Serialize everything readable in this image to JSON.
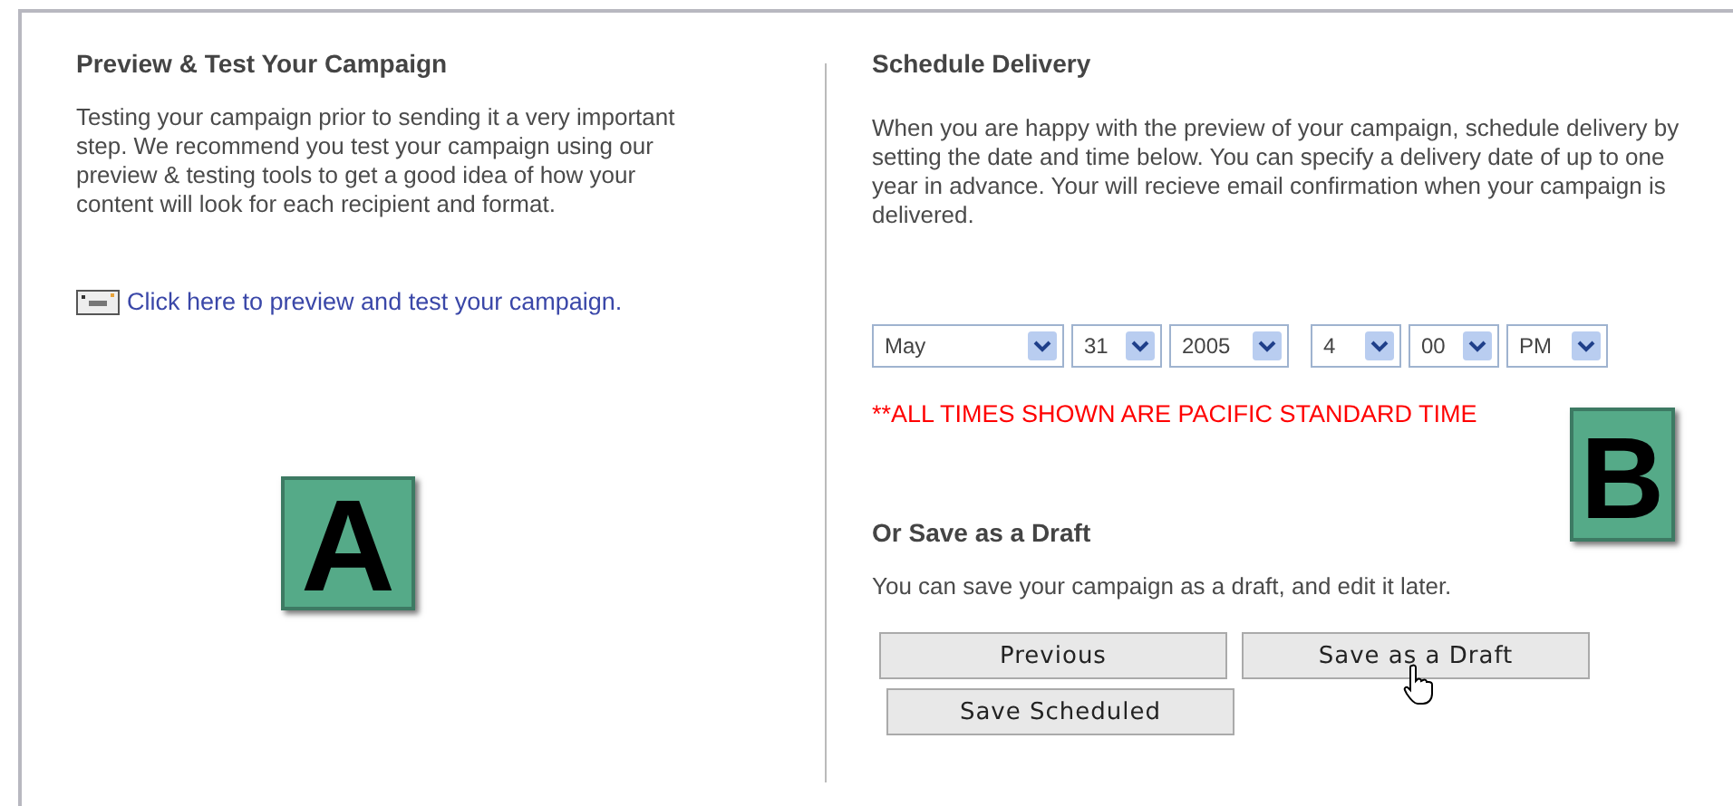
{
  "preview": {
    "title": "Preview & Test Your Campaign",
    "description": "Testing your campaign prior to sending it a very important step. We recommend you test your campaign using our preview & testing tools to get a good idea of how your content will look for each recipient and format.",
    "link": "Click here to preview and test your campaign."
  },
  "schedule": {
    "title": "Schedule Delivery",
    "description": "When you are happy with the preview of your campaign, schedule delivery by setting the date and time below. You can specify a delivery date of up to one year in advance. Your will recieve email confirmation when your campaign is delivered.",
    "selects": [
      {
        "value": "May",
        "kind": "month"
      },
      {
        "value": "31",
        "kind": "day"
      },
      {
        "value": "2005",
        "kind": "year"
      },
      {
        "value": "4",
        "kind": "hour"
      },
      {
        "value": "00",
        "kind": "minute"
      },
      {
        "value": "PM",
        "kind": "ampm"
      }
    ],
    "notice": "**ALL TIMES SHOWN ARE PACIFIC STANDARD TIME"
  },
  "draft": {
    "title": "Or Save as a Draft",
    "description": "You can save your campaign as a draft, and edit it later.",
    "buttons": [
      {
        "label": "Previous",
        "hovered": false
      },
      {
        "label": "Save as a Draft",
        "hovered": true
      },
      {
        "label": "Save Scheduled",
        "hovered": false
      }
    ]
  },
  "badges": [
    {
      "label": "A"
    },
    {
      "label": "B"
    }
  ]
}
